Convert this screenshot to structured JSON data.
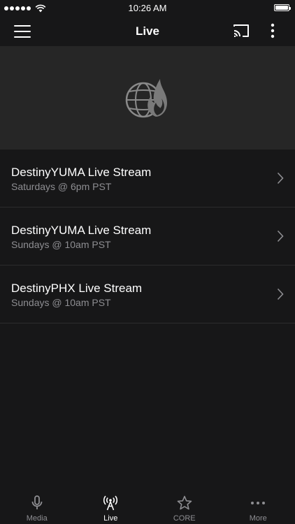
{
  "status_bar": {
    "time": "10:26 AM",
    "signal_bars": 5,
    "battery_level": 1.0
  },
  "nav": {
    "title": "Live"
  },
  "streams": [
    {
      "title": "DestinyYUMA Live Stream",
      "schedule": "Saturdays @ 6pm PST"
    },
    {
      "title": "DestinyYUMA Live Stream",
      "schedule": "Sundays @ 10am PST"
    },
    {
      "title": "DestinyPHX Live Stream",
      "schedule": "Sundays @ 10am PST"
    }
  ],
  "tabs": [
    {
      "label": "Media",
      "icon": "microphone-icon",
      "active": false
    },
    {
      "label": "Live",
      "icon": "broadcast-tower-icon",
      "active": true
    },
    {
      "label": "CORE",
      "icon": "star-icon",
      "active": false
    },
    {
      "label": "More",
      "icon": "ellipsis-icon",
      "active": false
    }
  ],
  "colors": {
    "background": "#171718",
    "hero": "#262626",
    "subtitle": "#8e8e92",
    "divider": "#2c2c2d",
    "active_tab": "#ffffff"
  }
}
